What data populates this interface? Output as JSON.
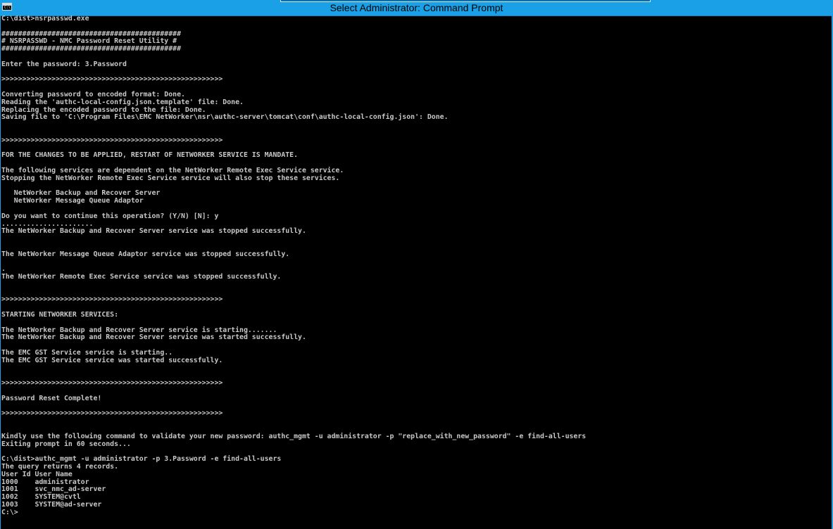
{
  "window": {
    "title": "Select Administrator: Command Prompt",
    "icon": "cmd-icon",
    "icon_text": "C:\\",
    "accent_color": "#1aa0e6"
  },
  "console": {
    "text_color": "#c8c8c8",
    "background": "#000000",
    "lines": [
      "C:\\dist>nsrpasswd.exe",
      "",
      "###########################################",
      "# NSRPASSWD - NMC Password Reset Utility #",
      "###########################################",
      "",
      "Enter the password: 3.Password",
      "",
      ">>>>>>>>>>>>>>>>>>>>>>>>>>>>>>>>>>>>>>>>>>>>>>>>>>>>>",
      "",
      "Converting password to encoded format: Done.",
      "Reading the 'authc-local-config.json.template' file: Done.",
      "Replacing the encoded password to the file: Done.",
      "Saving file to 'C:\\Program Files\\EMC NetWorker\\nsr\\authc-server\\tomcat\\conf\\authc-local-config.json': Done.",
      "",
      "",
      ">>>>>>>>>>>>>>>>>>>>>>>>>>>>>>>>>>>>>>>>>>>>>>>>>>>>>",
      "",
      "FOR THE CHANGES TO BE APPLIED, RESTART OF NETWORKER SERVICE IS MANDATE.",
      "",
      "The following services are dependent on the NetWorker Remote Exec Service service.",
      "Stopping the NetWorker Remote Exec Service service will also stop these services.",
      "",
      "   NetWorker Backup and Recover Server",
      "   NetWorker Message Queue Adaptor",
      "",
      "Do you want to continue this operation? (Y/N) [N]: y",
      "......................",
      "The NetWorker Backup and Recover Server service was stopped successfully.",
      "",
      "",
      "The NetWorker Message Queue Adaptor service was stopped successfully.",
      "",
      ".",
      "The NetWorker Remote Exec Service service was stopped successfully.",
      "",
      "",
      ">>>>>>>>>>>>>>>>>>>>>>>>>>>>>>>>>>>>>>>>>>>>>>>>>>>>>",
      "",
      "STARTING NETWORKER SERVICES:",
      "",
      "The NetWorker Backup and Recover Server service is starting.......",
      "The NetWorker Backup and Recover Server service was started successfully.",
      "",
      "The EMC GST Service service is starting..",
      "The EMC GST Service service was started successfully.",
      "",
      "",
      ">>>>>>>>>>>>>>>>>>>>>>>>>>>>>>>>>>>>>>>>>>>>>>>>>>>>>",
      "",
      "Password Reset Complete!",
      "",
      ">>>>>>>>>>>>>>>>>>>>>>>>>>>>>>>>>>>>>>>>>>>>>>>>>>>>>",
      "",
      "",
      "Kindly use the following command to validate your new password: authc_mgmt -u administrator -p \"replace_with_new_password\" -e find-all-users",
      "Exiting prompt in 60 seconds...",
      "",
      "C:\\dist>authc_mgmt -u administrator -p 3.Password -e find-all-users",
      "The query returns 4 records.",
      "User Id User Name",
      "1000    administrator",
      "1001    svc_nmc_ad-server",
      "1002    SYSTEM@cvtl",
      "1003    SYSTEM@ad-server",
      "C:\\>"
    ]
  }
}
